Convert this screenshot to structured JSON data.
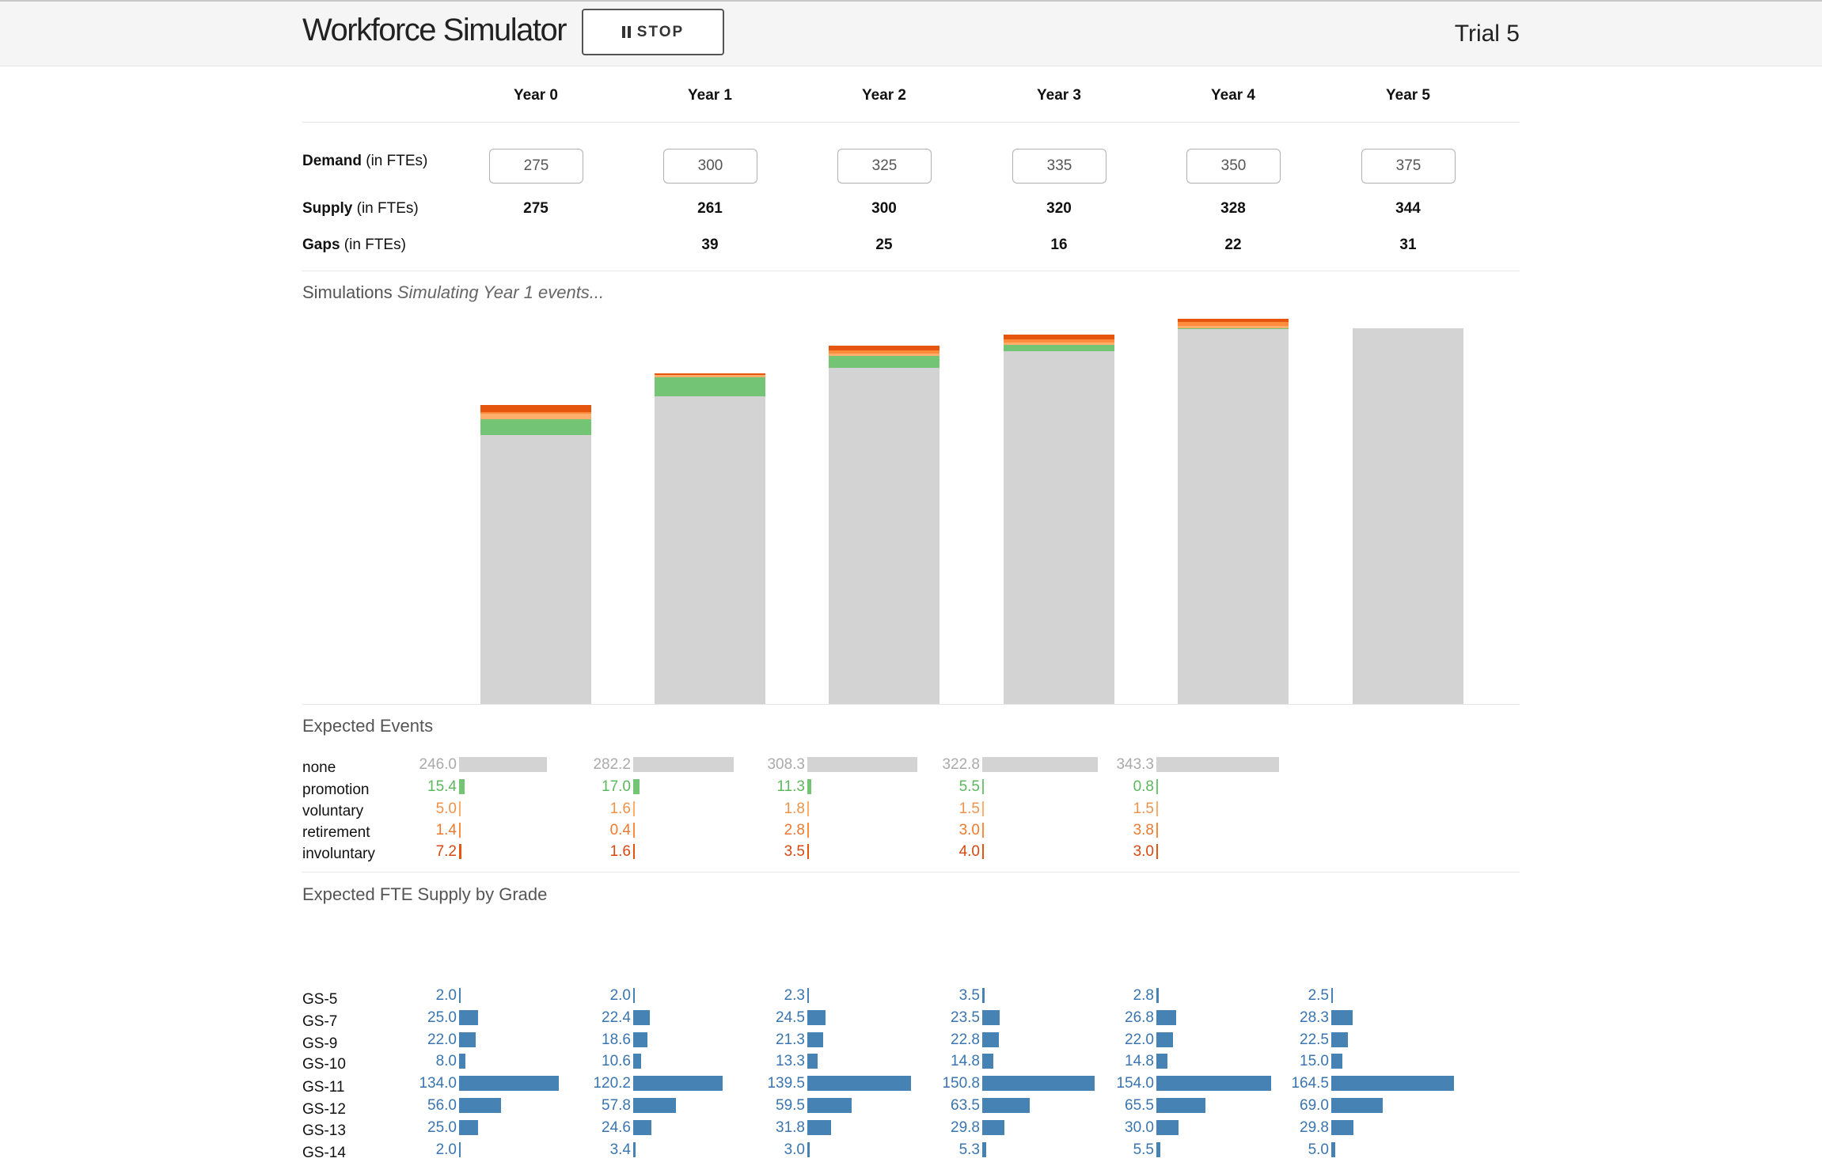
{
  "app": {
    "title": "Workforce Simulator",
    "stop_label": "STOP",
    "trial": "Trial 5"
  },
  "years": [
    "Year 0",
    "Year 1",
    "Year 2",
    "Year 3",
    "Year 4",
    "Year 5"
  ],
  "rows": {
    "demand": {
      "label": "Demand",
      "unit": " (in FTEs)",
      "values": [
        "275",
        "300",
        "325",
        "335",
        "350",
        "375"
      ]
    },
    "supply": {
      "label": "Supply",
      "unit": " (in FTEs)",
      "values": [
        "275",
        "261",
        "300",
        "320",
        "328",
        "344"
      ]
    },
    "gaps": {
      "label": "Gaps",
      "unit": " (in FTEs)",
      "values": [
        "",
        "39",
        "25",
        "16",
        "22",
        "31"
      ]
    }
  },
  "simulations": {
    "title": "Simulations",
    "status": "Simulating Year 1 events..."
  },
  "colors": {
    "none": "#d3d3d3",
    "promotion": "#74c476",
    "voluntary": "#fdae6b",
    "retirement": "#fd8d3c",
    "involuntary": "#e6550d",
    "grade": "#4682b4",
    "none_text": "#aaaaaa",
    "promotion_text": "#5cb85c",
    "voluntary_text": "#f0924a",
    "retirement_text": "#ee7a30",
    "involuntary_text": "#d9480f",
    "grade_text": "#3a75b0"
  },
  "chart_data": [
    {
      "type": "bar",
      "title": "Simulations",
      "categories": [
        "Year 0",
        "Year 1",
        "Year 2",
        "Year 3",
        "Year 4",
        "Year 5"
      ],
      "series": [
        {
          "name": "none",
          "values": [
            246,
            282,
            308,
            323,
            343,
            344
          ]
        },
        {
          "name": "promotion",
          "values": [
            15,
            17,
            11,
            6,
            1,
            0
          ]
        },
        {
          "name": "voluntary",
          "values": [
            5,
            2,
            2,
            2,
            2,
            0
          ]
        },
        {
          "name": "retirement",
          "values": [
            1,
            0,
            3,
            3,
            4,
            0
          ]
        },
        {
          "name": "involuntary",
          "values": [
            7,
            2,
            4,
            4,
            3,
            0
          ]
        }
      ],
      "ylim": [
        0,
        344
      ]
    },
    {
      "type": "bar",
      "title": "Expected Events",
      "categories": [
        "none",
        "promotion",
        "voluntary",
        "retirement",
        "involuntary"
      ],
      "series": [
        {
          "name": "Year 0",
          "values": [
            "246.0",
            "15.4",
            "5.0",
            "1.4",
            "7.2"
          ]
        },
        {
          "name": "Year 1",
          "values": [
            "282.2",
            "17.0",
            "1.6",
            "0.4",
            "1.6"
          ]
        },
        {
          "name": "Year 2",
          "values": [
            "308.3",
            "11.3",
            "1.8",
            "2.8",
            "3.5"
          ]
        },
        {
          "name": "Year 3",
          "values": [
            "322.8",
            "5.5",
            "1.5",
            "3.0",
            "4.0"
          ]
        },
        {
          "name": "Year 4",
          "values": [
            "343.3",
            "0.8",
            "1.5",
            "3.8",
            "3.0"
          ]
        }
      ]
    },
    {
      "type": "bar",
      "title": "Expected FTE Supply by Grade",
      "categories": [
        "GS-5",
        "GS-7",
        "GS-9",
        "GS-10",
        "GS-11",
        "GS-12",
        "GS-13",
        "GS-14"
      ],
      "series": [
        {
          "name": "Year 0",
          "values": [
            "2.0",
            "25.0",
            "22.0",
            "8.0",
            "134.0",
            "56.0",
            "25.0",
            "2.0"
          ]
        },
        {
          "name": "Year 1",
          "values": [
            "2.0",
            "22.4",
            "18.6",
            "10.6",
            "120.2",
            "57.8",
            "24.6",
            "3.4"
          ]
        },
        {
          "name": "Year 2",
          "values": [
            "2.3",
            "24.5",
            "21.3",
            "13.3",
            "139.5",
            "59.5",
            "31.8",
            "3.0"
          ]
        },
        {
          "name": "Year 3",
          "values": [
            "3.5",
            "23.5",
            "22.8",
            "14.8",
            "150.8",
            "63.5",
            "29.8",
            "5.3"
          ]
        },
        {
          "name": "Year 4",
          "values": [
            "2.8",
            "26.8",
            "22.0",
            "14.8",
            "154.0",
            "65.5",
            "30.0",
            "5.5"
          ]
        },
        {
          "name": "Year 5",
          "values": [
            "2.5",
            "28.3",
            "22.5",
            "15.0",
            "164.5",
            "69.0",
            "29.8",
            "5.0"
          ]
        }
      ]
    }
  ],
  "events_section": {
    "title": "Expected Events"
  },
  "grades_section": {
    "title": "Expected FTE Supply by Grade"
  }
}
